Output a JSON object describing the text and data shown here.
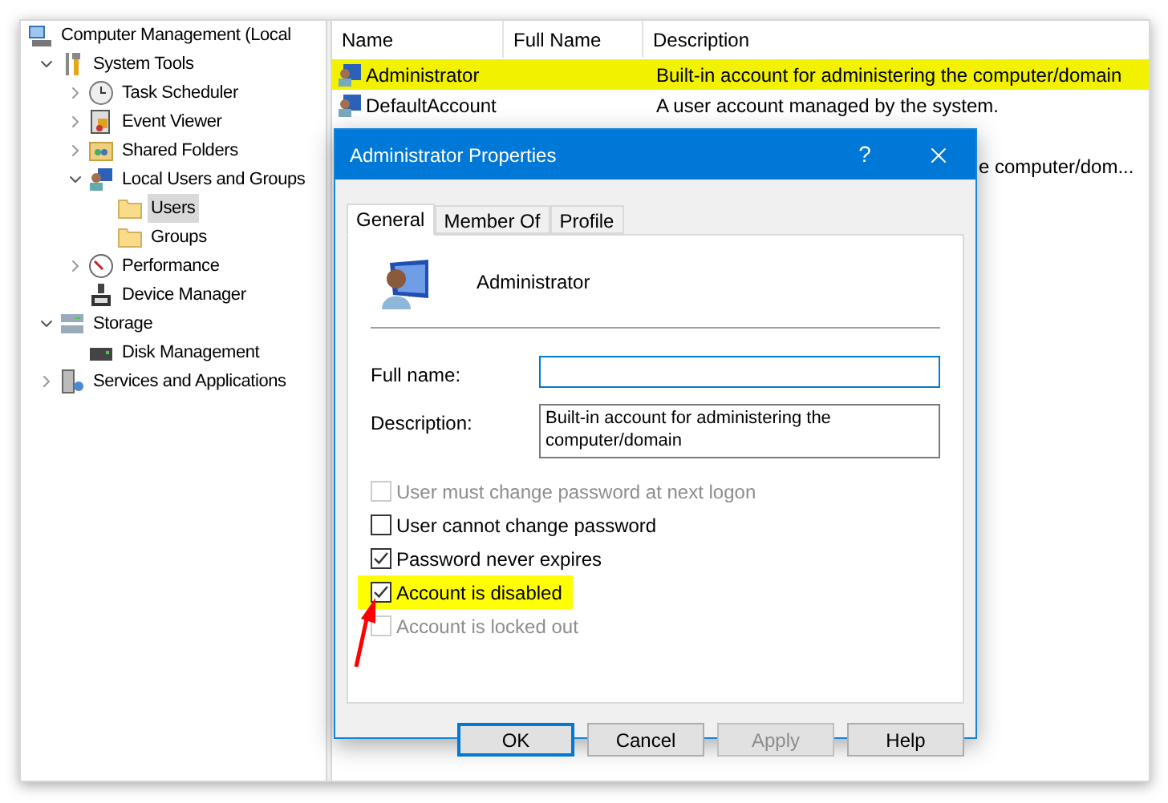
{
  "tree": [
    {
      "label": "Computer Management (Local",
      "kind": "computer",
      "children": [
        {
          "label": "System Tools",
          "kind": "tools",
          "expanded": true,
          "children": [
            {
              "label": "Task Scheduler",
              "kind": "clock",
              "expanded": false
            },
            {
              "label": "Event Viewer",
              "kind": "log",
              "expanded": false
            },
            {
              "label": "Shared Folders",
              "kind": "share",
              "expanded": false
            },
            {
              "label": "Local Users and Groups",
              "kind": "users",
              "expanded": true,
              "children": [
                {
                  "label": "Users",
                  "kind": "folder",
                  "selected": true
                },
                {
                  "label": "Groups",
                  "kind": "folder",
                  "selected": false
                }
              ]
            },
            {
              "label": "Performance",
              "kind": "gauge",
              "expanded": false
            },
            {
              "label": "Device Manager",
              "kind": "device"
            }
          ]
        },
        {
          "label": "Storage",
          "kind": "storage",
          "expanded": true,
          "children": [
            {
              "label": "Disk Management",
              "kind": "disk"
            }
          ]
        },
        {
          "label": "Services and Applications",
          "kind": "services",
          "expanded": false
        }
      ]
    }
  ],
  "table": {
    "columns": [
      "Name",
      "Full Name",
      "Description"
    ],
    "rows": [
      {
        "kind": "full",
        "name": "Administrator",
        "description": "Built-in account for administering the computer/domain",
        "highlighted": true
      },
      {
        "kind": "full",
        "name": "DefaultAccount",
        "description": "A user account managed by the system.",
        "highlighted": false
      },
      {
        "kind": "partial",
        "description": "e computer/dom..."
      }
    ]
  },
  "dialog": {
    "title": "Administrator Properties",
    "help": "?",
    "tabs": [
      {
        "label": "General",
        "selected": true
      },
      {
        "label": "Member Of",
        "selected": false
      },
      {
        "label": "Profile",
        "selected": false
      }
    ],
    "user_name": "Administrator",
    "fields": [
      {
        "kind": "line",
        "label": "Full name:",
        "focused": true
      },
      {
        "kind": "multi",
        "label": "Description:",
        "value": "Built-in account for administering the computer/domain",
        "focused": false
      }
    ],
    "checkboxes": [
      {
        "label": "User must change password at next logon",
        "checked": false,
        "disabled": true,
        "highlighted": false
      },
      {
        "label": "User cannot change password",
        "checked": false,
        "disabled": false,
        "highlighted": false
      },
      {
        "label": "Password never expires",
        "checked": true,
        "disabled": false,
        "highlighted": false
      },
      {
        "label": "Account is disabled",
        "checked": true,
        "disabled": false,
        "highlighted": true
      },
      {
        "label": "Account is locked out",
        "checked": false,
        "disabled": true,
        "highlighted": false
      }
    ],
    "buttons": [
      {
        "label": "OK",
        "default": true,
        "disabled": false
      },
      {
        "label": "Cancel",
        "default": false,
        "disabled": false
      },
      {
        "label": "Apply",
        "default": false,
        "disabled": true
      },
      {
        "label": "Help",
        "default": false,
        "disabled": false
      }
    ]
  }
}
